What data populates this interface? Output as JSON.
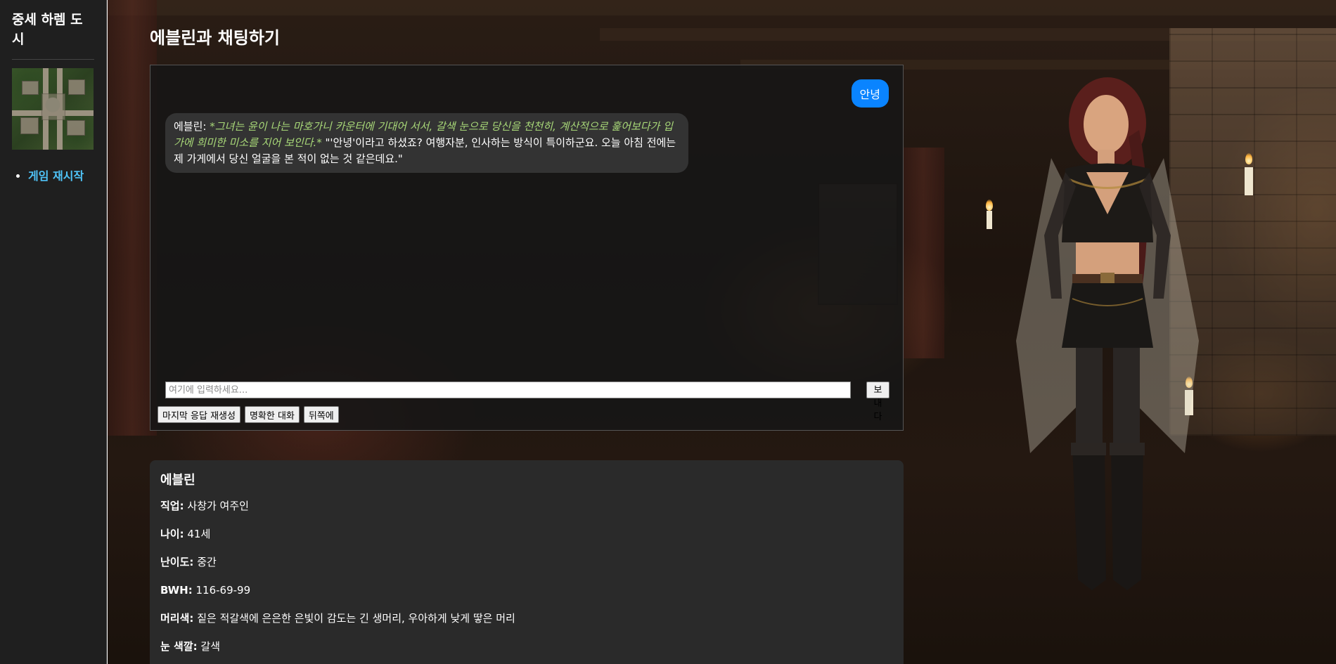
{
  "sidebar": {
    "site_title": "중세 하렘 도시",
    "nav_items": [
      {
        "label": "게임 재시작"
      }
    ]
  },
  "main": {
    "page_title": "에블린과 채팅하기"
  },
  "chat": {
    "messages": [
      {
        "role": "user",
        "text": "안녕"
      },
      {
        "role": "character",
        "speaker": "에블린:",
        "action": "*그녀는 윤이 나는 마호가니 카운터에 기대어 서서, 갈색 눈으로 당신을 천천히, 계산적으로 훑어보다가 입가에 희미한 미소를 지어 보인다.*",
        "speech": "\"'안녕'이라고 하셨죠? 여행자분, 인사하는 방식이 특이하군요. 오늘 아침 전에는 제 가게에서 당신 얼굴을 본 적이 없는 것 같은데요.\""
      }
    ],
    "input": {
      "placeholder": "여기에 입력하세요...",
      "value": ""
    },
    "send_label": "보내다",
    "actions": [
      "마지막 응답 재생성",
      "명확한 대화",
      "뒤쪽에"
    ]
  },
  "character_info": {
    "name": "에블린",
    "fields": [
      {
        "label": "직업:",
        "value": "사창가 여주인"
      },
      {
        "label": "나이:",
        "value": "41세"
      },
      {
        "label": "난이도:",
        "value": "중간"
      },
      {
        "label": "BWH:",
        "value": "116-69-99"
      },
      {
        "label": "머리색:",
        "value": "짙은 적갈색에 은은한 은빛이 감도는 긴 생머리, 우아하게 낮게 땋은 머리"
      },
      {
        "label": "눈 색깔:",
        "value": "갈색"
      }
    ]
  },
  "colors": {
    "user_bubble": "#0a84ff",
    "action_text": "#a8d878",
    "nav_link": "#4fc3f7"
  }
}
